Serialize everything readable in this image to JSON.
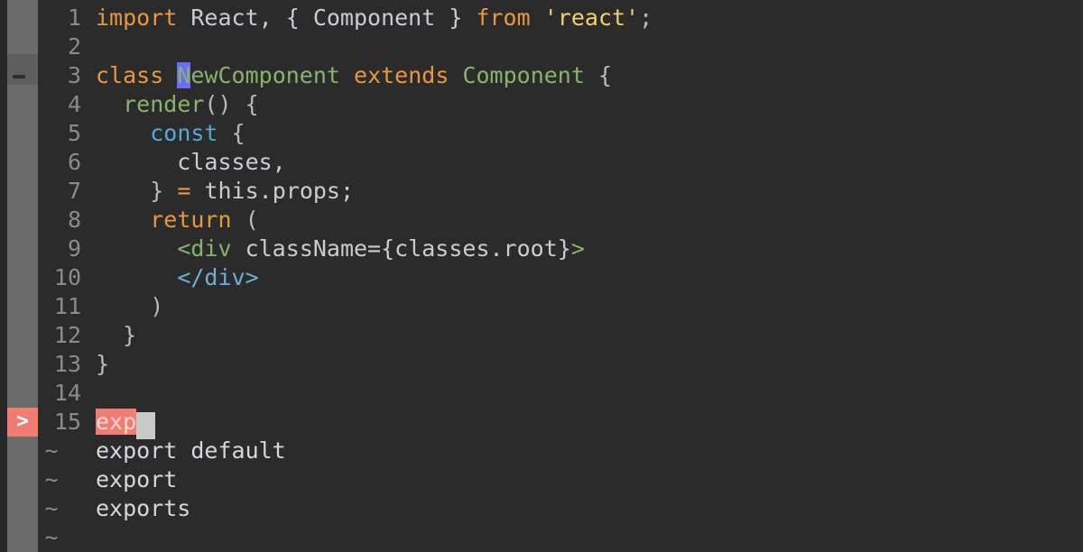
{
  "editor": {
    "filetype": "jsx",
    "background": "#2b2b2b",
    "gutter_color": "#6b6b6b",
    "error_color": "#f07c72",
    "match_highlight_color": "#6c6cfa",
    "cursor_color": "#c9c9c9"
  },
  "gutter": {
    "fold_marker": "—",
    "error_chevron": ">",
    "error_line_number": "15"
  },
  "lines": [
    {
      "number": "1",
      "tokens": [
        {
          "text": "import",
          "kind": "keyword"
        },
        {
          "text": " React, { Component } ",
          "kind": "plain"
        },
        {
          "text": "from",
          "kind": "keyword"
        },
        {
          "text": " ",
          "kind": "plain"
        },
        {
          "text": "'react'",
          "kind": "string"
        },
        {
          "text": ";",
          "kind": "punct"
        }
      ]
    },
    {
      "number": "2",
      "tokens": []
    },
    {
      "number": "3",
      "tokens": [
        {
          "text": "class",
          "kind": "keyword"
        },
        {
          "text": " ",
          "kind": "plain"
        },
        {
          "text": "N",
          "kind": "type",
          "highlight": "match"
        },
        {
          "text": "ewComponent",
          "kind": "type"
        },
        {
          "text": " ",
          "kind": "plain"
        },
        {
          "text": "extends",
          "kind": "keyword"
        },
        {
          "text": " ",
          "kind": "plain"
        },
        {
          "text": "Component",
          "kind": "type"
        },
        {
          "text": " ",
          "kind": "plain"
        },
        {
          "text": "{",
          "kind": "punct"
        }
      ]
    },
    {
      "number": "4",
      "tokens": [
        {
          "text": "  ",
          "kind": "plain"
        },
        {
          "text": "render",
          "kind": "type"
        },
        {
          "text": "() {",
          "kind": "punct"
        }
      ]
    },
    {
      "number": "5",
      "tokens": [
        {
          "text": "    ",
          "kind": "plain"
        },
        {
          "text": "const",
          "kind": "const"
        },
        {
          "text": " ",
          "kind": "plain"
        },
        {
          "text": "{",
          "kind": "punct"
        }
      ]
    },
    {
      "number": "6",
      "tokens": [
        {
          "text": "      classes,",
          "kind": "plain"
        }
      ]
    },
    {
      "number": "7",
      "tokens": [
        {
          "text": "    ",
          "kind": "plain"
        },
        {
          "text": "}",
          "kind": "punct"
        },
        {
          "text": " ",
          "kind": "plain"
        },
        {
          "text": "=",
          "kind": "keyword"
        },
        {
          "text": " this.props;",
          "kind": "plain"
        }
      ]
    },
    {
      "number": "8",
      "tokens": [
        {
          "text": "    ",
          "kind": "plain"
        },
        {
          "text": "return",
          "kind": "keyword"
        },
        {
          "text": " (",
          "kind": "punct"
        }
      ]
    },
    {
      "number": "9",
      "tokens": [
        {
          "text": "      ",
          "kind": "plain"
        },
        {
          "text": "<div",
          "kind": "type"
        },
        {
          "text": " className={classes.root}",
          "kind": "plain"
        },
        {
          "text": ">",
          "kind": "type"
        }
      ]
    },
    {
      "number": "10",
      "tokens": [
        {
          "text": "      ",
          "kind": "plain"
        },
        {
          "text": "</div>",
          "kind": "tag"
        }
      ]
    },
    {
      "number": "11",
      "tokens": [
        {
          "text": "    )",
          "kind": "punct"
        }
      ]
    },
    {
      "number": "12",
      "tokens": [
        {
          "text": "  }",
          "kind": "punct"
        }
      ]
    },
    {
      "number": "13",
      "tokens": [
        {
          "text": "}",
          "kind": "punct"
        }
      ]
    },
    {
      "number": "14",
      "tokens": []
    },
    {
      "number": "15",
      "tokens": [
        {
          "text": "exp",
          "kind": "plain",
          "highlight": "error"
        },
        {
          "text": "",
          "kind": "cursor"
        }
      ]
    }
  ],
  "suggestions": {
    "tilde_glyph": "~",
    "items": [
      {
        "label": "export default"
      },
      {
        "label": "export"
      },
      {
        "label": "exports"
      },
      {
        "label": ""
      }
    ]
  }
}
